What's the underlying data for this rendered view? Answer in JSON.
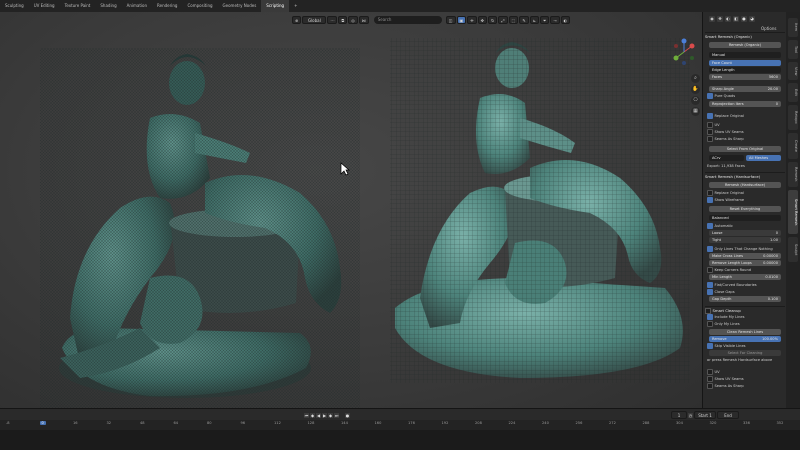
{
  "workspace_tabs": [
    "Sculpting",
    "UV Editing",
    "Texture Paint",
    "Shading",
    "Animation",
    "Rendering",
    "Compositing",
    "Geometry Nodes",
    "Scripting",
    "+"
  ],
  "active_tab_index": 8,
  "viewport_header": {
    "orientation_label": "Global",
    "search_placeholder": "Search"
  },
  "panel": {
    "options_label": "Options",
    "smart_remesh_organic_title": "Smart Remesh (Organic)",
    "remesh_organic_button": "Remesh (Organic)",
    "method_label": "Manual",
    "face_count_label": "Face Count",
    "edge_length_label": "Edge Length",
    "faces_label": "Faces",
    "faces_value": "5600",
    "sharp_angle_label": "Sharp Angle",
    "sharp_angle_value": "20.00",
    "pure_quads_label": "Pure Quads",
    "reprojection_label": "Reprojection Iters",
    "reprojection_value": "0",
    "replace_original_label": "Replace Original",
    "uv_label": "UV",
    "show_uv_seams_label": "Show UV Seams",
    "seams_as_sharp_label": "Seams As Sharp",
    "select_from_original_label": "Select From Original",
    "mode_left": "ACrv",
    "mode_right": "All Meshes",
    "export_label": "Export: 11,938 Faces",
    "smart_remesh_hard_title": "Smart Remesh (Hardsurface)",
    "remesh_hard_button": "Remesh (Hardsurface)",
    "replace_original_2": "Replace Original",
    "show_wireframe_label": "Show Wireframe",
    "reset_everything_label": "Reset Everything",
    "balanced_label": "Balanced",
    "automatic_label": "Automatic",
    "loose_label": "Loose",
    "tight_label": "Tight",
    "loose_value": "0",
    "tight_value": "1.00",
    "only_lines_label": "Only Lines That Change Nothing",
    "make_cross_label": "Make Cross Lines",
    "make_cross_value": "0.00000",
    "remove_length_label": "Remove Length Loops",
    "remove_length_value": "0.00000",
    "keep_corners_label": "Keep Corners Round",
    "min_length_label": "Min Length",
    "min_length_value": "0.0100",
    "flat_curved_label": "Flat/Curved Boundaries",
    "clone_gaps_label": "Close Gaps",
    "gap_depth_label": "Gap Depth",
    "gap_depth_value": "0.100",
    "smart_cleanup_title": "Smart Cleanup",
    "include_my_lines_label": "Include My Lines",
    "only_my_lines_label": "Only My Lines",
    "clean_remesh_lines_label": "Clean Remesh Lines",
    "remove_label": "Remove",
    "remove_value": "100.00%",
    "skip_visible_lines_label": "Skip Visible Lines",
    "select_for_cleaning_label": "Select For Cleaning",
    "press_remesh_label": "or press Remesh Hardsurface above",
    "uv_label_2": "UV",
    "show_uv_seams_2": "Show UV Seams",
    "seams_as_sharp_2": "Seams As Sharp"
  },
  "side_tabs": [
    "Item",
    "Tool",
    "View",
    "Edit",
    "Retopo",
    "Create",
    "Remesh",
    "Smart Remesh",
    "Sculpt"
  ],
  "timeline": {
    "frames": [
      "-8",
      "0",
      "16",
      "32",
      "48",
      "64",
      "80",
      "96",
      "112",
      "128",
      "144",
      "160",
      "176",
      "192",
      "208",
      "224",
      "240",
      "256",
      "272",
      "288",
      "304",
      "320",
      "336",
      "352"
    ],
    "current_frame_label": "1",
    "start_label": "Start",
    "start_value": "1",
    "end_label": "End",
    "end_value": "250"
  },
  "colors": {
    "accent_blue": "#4772b3",
    "panel_bg": "#2a2a2a",
    "viewport_bg": "#3f3f3f",
    "mesh_teal": "#3f7c74"
  }
}
